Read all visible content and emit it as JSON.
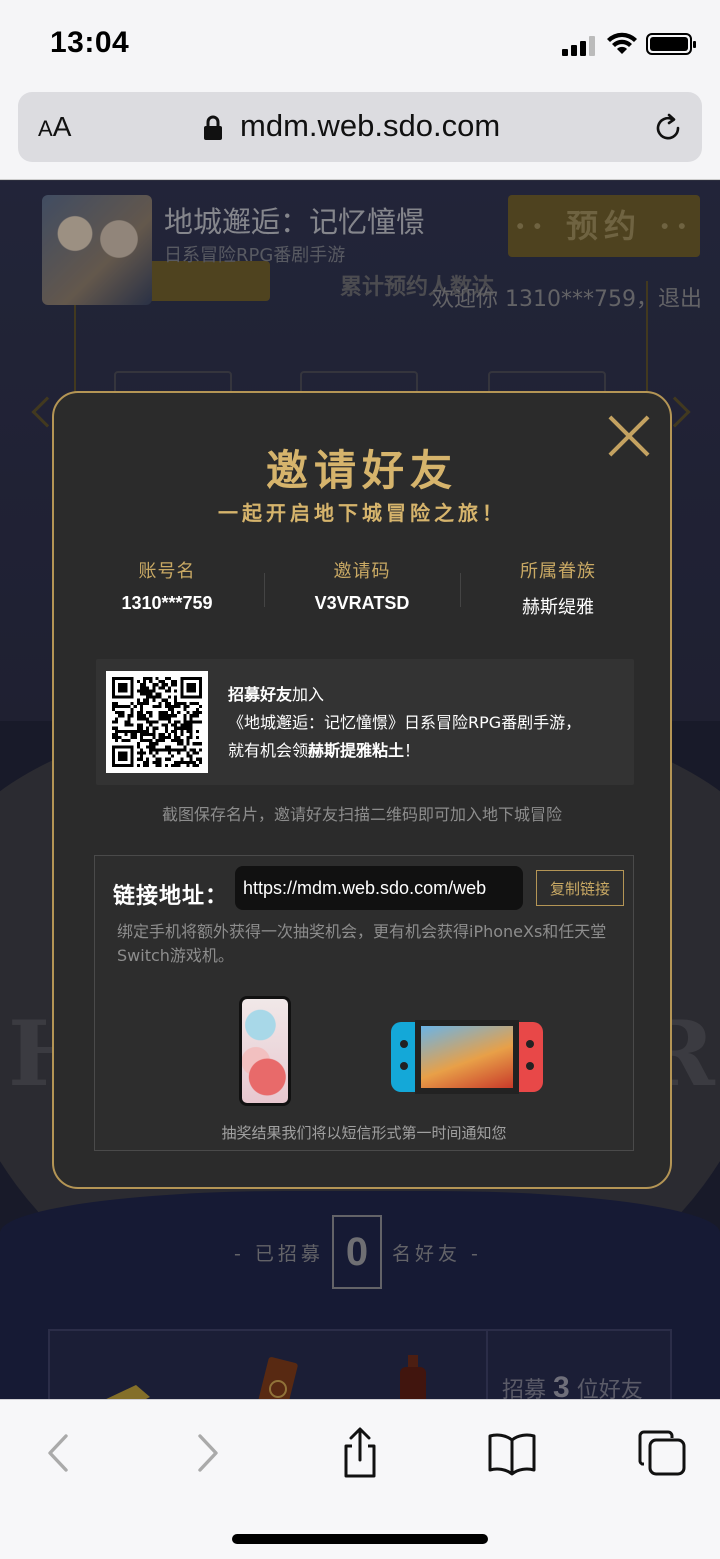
{
  "status_bar": {
    "time": "13:04"
  },
  "browser": {
    "aa_label_small": "A",
    "aa_label_large": "A",
    "url": "mdm.web.sdo.com"
  },
  "background_page": {
    "banner_title": "地城邂逅：记忆憧憬",
    "banner_subtitle": "日系冒险RPG番剧手游",
    "reserve_button": "预约",
    "total_text": "累计预约人数达",
    "welcome_text": "欢迎你  1310***759，",
    "logout_link": "退出",
    "recruit_prefix": "- 已招募",
    "recruit_count": "0",
    "recruit_suffix": "名好友 -",
    "recruit_target_prefix": "招募",
    "recruit_target_count": "3",
    "recruit_target_suffix": "位好友"
  },
  "modal": {
    "title": "邀请好友",
    "subtitle": "一起开启地下城冒险之旅！",
    "info": [
      {
        "label": "账号名",
        "value": "1310***759"
      },
      {
        "label": "邀请码",
        "value": "V3VRATSD"
      },
      {
        "label": "所属眷族",
        "value": "赫斯缇雅"
      }
    ],
    "qr_text_bold1": "招募好友",
    "qr_text_1": "加入",
    "qr_text_2": "《地城邂逅：记忆憧憬》日系冒险RPG番剧手游，",
    "qr_text_3": "就有机会领",
    "qr_text_bold2": "赫斯提雅粘土",
    "qr_text_4": "！",
    "save_hint": "截图保存名片，邀请好友扫描二维码即可加入地下城冒险",
    "link_label": "链接地址：",
    "link_value": "https://mdm.web.sdo.com/web",
    "copy_button": "复制链接",
    "bind_desc": "绑定手机将额外获得一次抽奖机会，更有机会获得iPhoneXs和任天堂Switch游戏机。",
    "notify_text": "抽奖结果我们将以短信形式第一时间通知您"
  },
  "colors": {
    "gold": "#d6b46c",
    "modal_bg": "#2b2b2b",
    "modal_border": "#b49555"
  }
}
